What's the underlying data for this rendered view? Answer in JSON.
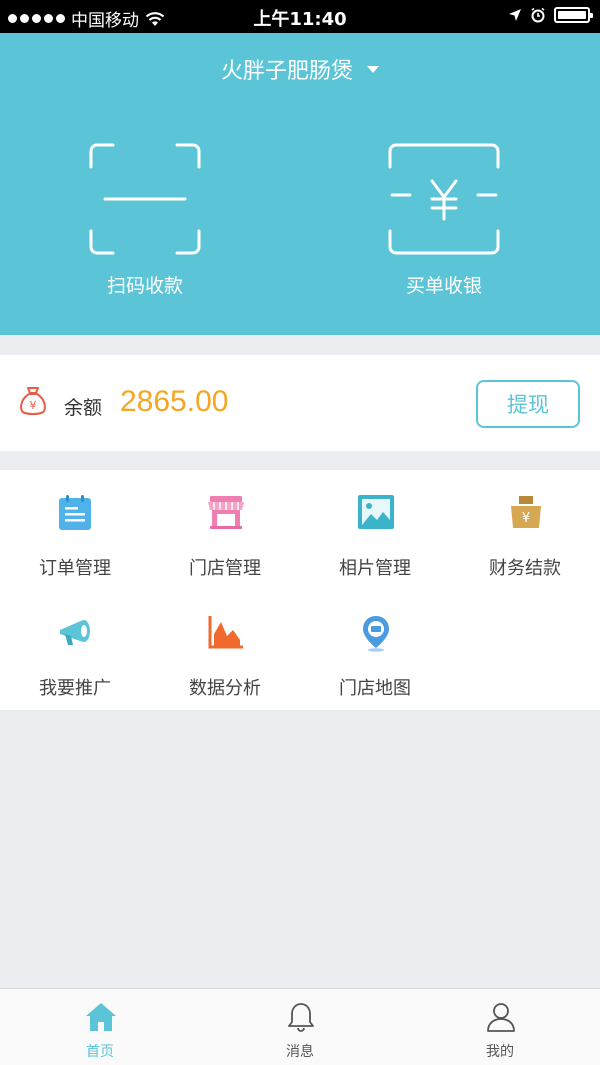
{
  "status_bar": {
    "carrier": "中国移动",
    "time": "上午11:40"
  },
  "header": {
    "store_name": "火胖子肥肠煲",
    "actions": [
      {
        "label": "扫码收款",
        "icon": "scan-icon"
      },
      {
        "label": "买单收银",
        "icon": "cashier-yen-icon"
      }
    ]
  },
  "balance": {
    "label": "余额",
    "value": "2865.00",
    "currency_icon": "¥",
    "withdraw_label": "提现"
  },
  "menu": {
    "items": [
      {
        "label": "订单管理",
        "icon": "order-icon"
      },
      {
        "label": "门店管理",
        "icon": "store-icon"
      },
      {
        "label": "相片管理",
        "icon": "photo-icon"
      },
      {
        "label": "财务结款",
        "icon": "finance-icon"
      },
      {
        "label": "我要推广",
        "icon": "promote-icon"
      },
      {
        "label": "数据分析",
        "icon": "chart-icon"
      },
      {
        "label": "门店地图",
        "icon": "map-pin-icon"
      }
    ]
  },
  "tab_bar": {
    "tabs": [
      {
        "label": "首页",
        "active": true
      },
      {
        "label": "消息",
        "active": false
      },
      {
        "label": "我的",
        "active": false
      }
    ]
  },
  "colors": {
    "primary": "#5bc4d6",
    "balance": "#f5a623",
    "background": "#ebedf1"
  }
}
